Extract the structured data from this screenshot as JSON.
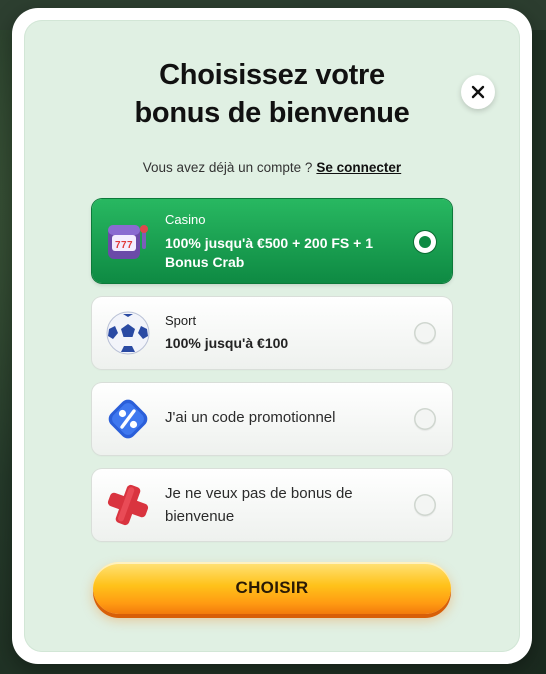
{
  "modal": {
    "title_line1": "Choisissez votre",
    "title_line2": "bonus de bienvenue",
    "subtitle_text": "Vous avez déjà un compte ?",
    "login_link": "Se connecter",
    "close_icon": "close-icon"
  },
  "options": [
    {
      "category": "Casino",
      "text": "100% jusqu'à €500 + 200 FS + 1 Bonus Crab",
      "icon": "slot-machine-icon",
      "selected": true
    },
    {
      "category": "Sport",
      "text": "100% jusqu'à €100",
      "icon": "soccer-ball-icon",
      "selected": false
    },
    {
      "category": "",
      "text": "J'ai un code promotionnel",
      "icon": "percent-badge-icon",
      "selected": false
    },
    {
      "category": "",
      "text": "Je ne veux pas de bonus de bienvenue",
      "icon": "red-cross-icon",
      "selected": false
    }
  ],
  "cta": {
    "label": "CHOISIR"
  },
  "colors": {
    "selected_green": "#16a34f",
    "cta_orange": "#ffb01a",
    "panel_bg": "#e0f0e3"
  }
}
